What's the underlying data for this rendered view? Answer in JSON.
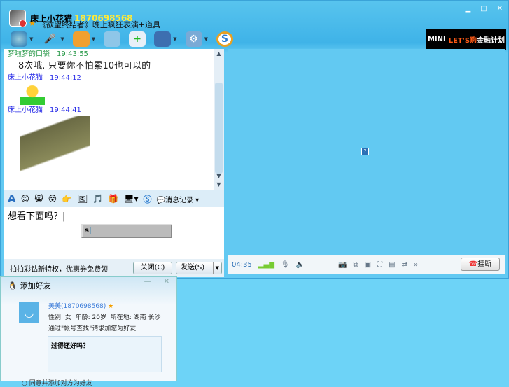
{
  "header": {
    "name": "床上小花猫",
    "qq": "1870698568",
    "signature": "《欲望终结者》晚上疯狂表演+道具"
  },
  "ad": {
    "prefix": "MINI",
    "highlight": "LET'S购",
    "suffix": "金融计划"
  },
  "messages": [
    {
      "sender": "梦啦梦的口袋",
      "time": "19:43:55",
      "text": "8次哦. 只要你不怕累10也可以的"
    },
    {
      "sender": "床上小花猫",
      "time": "19:44:12",
      "text": ""
    },
    {
      "sender": "床上小花猫",
      "time": "19:44:41",
      "text": ""
    }
  ],
  "editor": {
    "history_label": "消息记录",
    "input_text": "想看下面吗？",
    "ime_text": "s"
  },
  "bottom": {
    "promo": "拍拍彩钻新特权，优惠券免费领",
    "close_label": "关闭(C)",
    "send_label": "发送(S)"
  },
  "video": {
    "time": "04:35",
    "hangup_label": "挂断",
    "more": "»"
  },
  "add_friend": {
    "title": "添加好友",
    "user": "美美(1870698568)",
    "gender": "性别: 女",
    "age": "年龄: 20岁",
    "location": "所在地: 湖南 长沙",
    "request": "通过\"帐号查找\"请求加您为好友",
    "message": "过得还好吗？",
    "option": "同意并添加对方为好友"
  }
}
